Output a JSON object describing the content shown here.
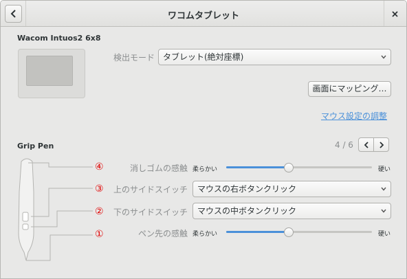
{
  "window": {
    "title": "ワコムタブレット"
  },
  "tablet": {
    "device_name": "Wacom Intuos2 6x8",
    "tracking_mode_label": "検出モード",
    "tracking_mode_value": "タブレット(絶対座標)",
    "map_button_label": "画面にマッピング…",
    "mouse_settings_link": "マウス設定の調整"
  },
  "stylus": {
    "name": "Grip Pen",
    "page_indicator": "4 / 6",
    "eraser_label": "消しゴムの感触",
    "upper_switch_label": "上のサイドスイッチ",
    "upper_switch_value": "マウスの右ボタンクリック",
    "lower_switch_label": "下のサイドスイッチ",
    "lower_switch_value": "マウスの中ボタンクリック",
    "tip_label": "ペン先の感触",
    "soft_label": "柔らかい",
    "firm_label": "硬い",
    "eraser_feel": 0.43,
    "tip_feel": 0.43
  },
  "callouts": {
    "n1": "①",
    "n2": "②",
    "n3": "③",
    "n4": "④"
  },
  "colors": {
    "accent": "#4a90d9",
    "callout": "#e00000"
  }
}
